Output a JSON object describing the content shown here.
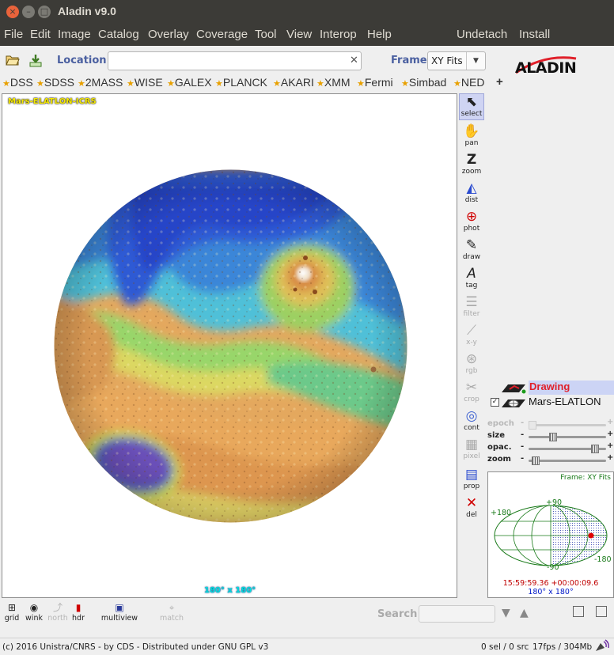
{
  "window": {
    "title": "Aladin v9.0",
    "close_glyph": "×",
    "min_glyph": "–",
    "max_glyph": "□"
  },
  "menu": {
    "items": [
      "File",
      "Edit",
      "Image",
      "Catalog",
      "Overlay",
      "Coverage",
      "Tool",
      "View",
      "Interop",
      "Help"
    ],
    "right_items": [
      "Undetach",
      "Install"
    ]
  },
  "toolbar": {
    "open_icon": "folder-open-icon",
    "load_icon": "download-icon",
    "location_label": "Location",
    "location_value": "",
    "clear_glyph": "✕",
    "frame_label": "Frame",
    "frame_value": "XY Fits",
    "frame_arrow": "▼",
    "logo_text": "ALADIN"
  },
  "surveys": {
    "items": [
      "DSS",
      "SDSS",
      "2MASS",
      "WISE",
      "GALEX",
      "PLANCK",
      "AKARI",
      "XMM",
      "Fermi",
      "Simbad",
      "NED"
    ],
    "star": "★",
    "add_label": "+"
  },
  "view": {
    "label": "Mars-ELATLON-ICRS",
    "fov": "180° x 180°"
  },
  "tools": [
    {
      "label": "select",
      "icon": "cursor-icon",
      "glyph": "⬉",
      "enabled": true
    },
    {
      "label": "pan",
      "icon": "hand-icon",
      "glyph": "✋",
      "enabled": true
    },
    {
      "label": "zoom",
      "icon": "zoom-icon",
      "glyph": "Z",
      "enabled": true
    },
    {
      "label": "dist",
      "icon": "ruler-icon",
      "glyph": "◭",
      "enabled": true
    },
    {
      "label": "phot",
      "icon": "crosshair-icon",
      "glyph": "⊕",
      "enabled": true
    },
    {
      "label": "draw",
      "icon": "pencil-icon",
      "glyph": "✎",
      "enabled": true
    },
    {
      "label": "tag",
      "icon": "text-tag-icon",
      "glyph": "A",
      "enabled": true
    },
    {
      "label": "filter",
      "icon": "filter-icon",
      "glyph": "☰",
      "enabled": false
    },
    {
      "label": "x-y",
      "icon": "xy-plot-icon",
      "glyph": "⟋",
      "enabled": false
    },
    {
      "label": "rgb",
      "icon": "rgb-circles-icon",
      "glyph": "⊛",
      "enabled": false
    },
    {
      "label": "crop",
      "icon": "scissors-icon",
      "glyph": "✂",
      "enabled": false
    },
    {
      "label": "cont",
      "icon": "contour-icon",
      "glyph": "◎",
      "enabled": true
    },
    {
      "label": "pixel",
      "icon": "pixel-icon",
      "glyph": "▦",
      "enabled": false
    },
    {
      "label": "prop",
      "icon": "properties-icon",
      "glyph": "▤",
      "enabled": true
    },
    {
      "label": "del",
      "icon": "delete-icon",
      "glyph": "✕",
      "enabled": true
    }
  ],
  "stack": {
    "drawing_label": "Drawing",
    "mars_label": "Mars-ELATLON",
    "mars_checked": "✓"
  },
  "sliders": [
    {
      "label": "epoch",
      "enabled": false,
      "level": 0.0
    },
    {
      "label": "size",
      "enabled": true,
      "level": 0.3
    },
    {
      "label": "opac.",
      "enabled": true,
      "level": 0.9
    },
    {
      "label": "zoom",
      "enabled": true,
      "level": 0.05
    }
  ],
  "slider_minus": "-",
  "slider_plus": "+",
  "minimap": {
    "frame": "Frame: XY Fits",
    "lab_top": "+90",
    "lab_bottom": "-90",
    "lab_left": "+180",
    "lab_right": "-180",
    "coords": "15:59:59.36 +00:00:09.6",
    "fov": "180° x 180°"
  },
  "bottom": {
    "buttons": [
      {
        "label": "grid",
        "icon": "grid-icon",
        "glyph": "⊞",
        "enabled": true
      },
      {
        "label": "wink",
        "icon": "eye-icon",
        "glyph": "◉",
        "enabled": true
      },
      {
        "label": "north",
        "icon": "north-arrow-icon",
        "glyph": "⤴",
        "enabled": false
      },
      {
        "label": "hdr",
        "icon": "hdr-histogram-icon",
        "glyph": "▮",
        "enabled": true
      },
      {
        "label": "multiview",
        "icon": "multiview-icon",
        "glyph": "▣",
        "enabled": true
      },
      {
        "label": "match",
        "icon": "match-icon",
        "glyph": "⌖",
        "enabled": false
      }
    ],
    "search_label": "Search",
    "down_glyph": "▼",
    "up_glyph": "▲"
  },
  "status": {
    "left": "(c) 2016 Unistra/CNRS - by CDS - Distributed under GNU GPL v3",
    "sel": "0 sel / 0 src",
    "fps": "17fps / 304Mb",
    "icon": "radio-dish-icon"
  },
  "colors": {
    "titlebar": "#3c3b37",
    "accent_label": "#4a5fa0",
    "drawing_bg": "#ccd4f5",
    "drawing_text": "#e0202a"
  }
}
